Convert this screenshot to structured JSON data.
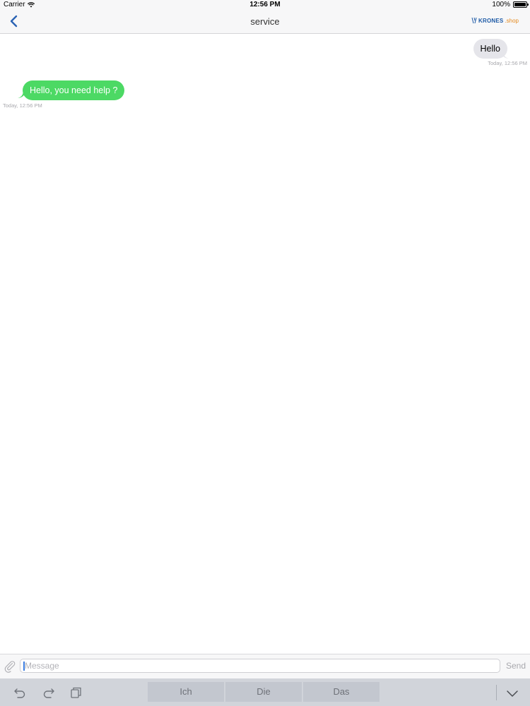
{
  "status_bar": {
    "carrier": "Carrier",
    "time": "12:56 PM",
    "battery": "100%"
  },
  "nav": {
    "title": "service",
    "logo_brand": "KRONES",
    "logo_suffix": ".shop"
  },
  "messages": [
    {
      "direction": "outgoing",
      "text": "Hello",
      "timestamp": "Today, 12:56 PM"
    },
    {
      "direction": "incoming",
      "text": "Hello, you need help ?",
      "timestamp": "Today, 12:56 PM"
    }
  ],
  "composer": {
    "placeholder": "Message",
    "send_label": "Send"
  },
  "keyboard": {
    "suggestions": [
      "Ich",
      "Die",
      "Das"
    ]
  },
  "colors": {
    "incoming_bubble": "#4cd964",
    "outgoing_bubble": "#e5e5ea",
    "accent": "#1d5aa6"
  }
}
